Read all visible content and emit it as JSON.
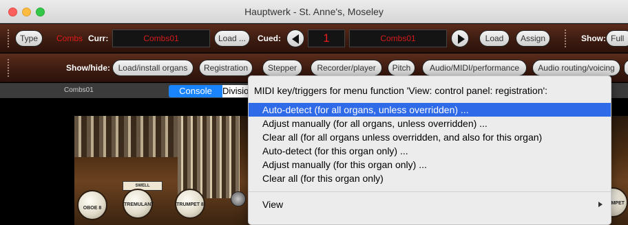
{
  "window": {
    "title": "Hauptwerk - St. Anne's, Moseley"
  },
  "toolbar1": {
    "type_label": "Type",
    "combs_label": "Combs",
    "curr_label": "Curr:",
    "curr_value": "Combs01",
    "load_dots_label": "Load ...",
    "cued_label": "Cued:",
    "cued_number": "1",
    "cued_value": "Combs01",
    "load_label": "Load",
    "assign_label": "Assign",
    "show_label": "Show:",
    "show_value": "Full"
  },
  "toolbar2": {
    "show_hide_label": "Show/hide:",
    "buttons": [
      "Load/install organs",
      "Registration",
      "Stepper",
      "Recorder/player",
      "Pitch",
      "Audio/MIDI/performance",
      "Audio routing/voicing"
    ]
  },
  "tabs": {
    "current_name": "Combs01",
    "console": "Console",
    "divisions": "Divisions"
  },
  "organ": {
    "swell_label": "SWELL",
    "stops": [
      "OBOE 8",
      "TREMULANT",
      "TRUMPET 8",
      "TRUMPET"
    ]
  },
  "menu": {
    "heading": "MIDI key/triggers for menu function 'View: control panel: registration':",
    "items": [
      "Auto-detect (for all organs, unless overridden) ...",
      "Adjust manually (for all organs, unless overridden) ...",
      "Clear all (for all organs unless overridden, and also for this organ)",
      "Auto-detect (for this organ only) ...",
      "Adjust manually (for this organ only) ...",
      "Clear all (for this organ only)"
    ],
    "submenu_label": "View",
    "selected_color": "#2f6ae8"
  },
  "colors": {
    "toolbar_brown": "#3b1a10",
    "lcd_red": "#d61a1a",
    "tab_active": "#1a84ff"
  }
}
